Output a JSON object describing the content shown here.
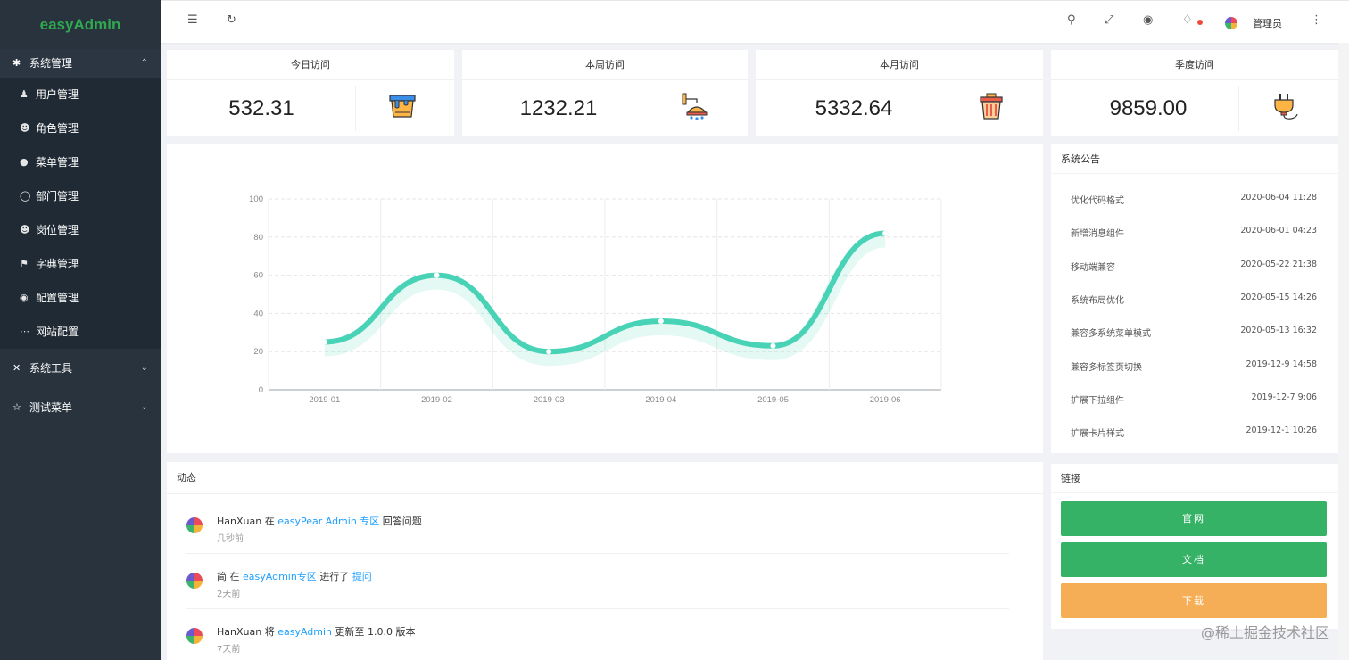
{
  "app": {
    "logo": "easyAdmin"
  },
  "sidebar": {
    "system": {
      "label": "系统管理",
      "items": [
        {
          "label": "用户管理",
          "icon": "user-icon"
        },
        {
          "label": "角色管理",
          "icon": "role-icon"
        },
        {
          "label": "菜单管理",
          "icon": "menu-icon"
        },
        {
          "label": "部门管理",
          "icon": "shield-icon"
        },
        {
          "label": "岗位管理",
          "icon": "post-icon"
        },
        {
          "label": "字典管理",
          "icon": "flag-icon"
        },
        {
          "label": "配置管理",
          "icon": "globe-icon"
        },
        {
          "label": "网站配置",
          "icon": "dots-icon"
        }
      ]
    },
    "tools": {
      "label": "系统工具"
    },
    "test": {
      "label": "测试菜单"
    }
  },
  "header": {
    "admin_name": "管理员"
  },
  "stats": [
    {
      "title": "今日访问",
      "value": "532.31",
      "icon": "paint-bucket-icon"
    },
    {
      "title": "本周访问",
      "value": "1232.21",
      "icon": "lamp-icon"
    },
    {
      "title": "本月访问",
      "value": "5332.64",
      "icon": "trash-icon"
    },
    {
      "title": "季度访问",
      "value": "9859.00",
      "icon": "plug-icon"
    }
  ],
  "chart_data": {
    "type": "line",
    "categories": [
      "2019-01",
      "2019-02",
      "2019-03",
      "2019-04",
      "2019-05",
      "2019-06"
    ],
    "values": [
      25,
      60,
      20,
      36,
      23,
      82
    ],
    "ylim": [
      0,
      100
    ],
    "yticks": [
      "0",
      "20",
      "40",
      "60",
      "80",
      "100"
    ],
    "color": "#48d2b6",
    "smooth": true,
    "grid": true
  },
  "notice": {
    "title": "系统公告",
    "items": [
      {
        "title": "优化代码格式",
        "time": "2020-06-04 11:28"
      },
      {
        "title": "新增消息组件",
        "time": "2020-06-01 04:23"
      },
      {
        "title": "移动端兼容",
        "time": "2020-05-22 21:38"
      },
      {
        "title": "系统布局优化",
        "time": "2020-05-15 14:26"
      },
      {
        "title": "兼容多系统菜单模式",
        "time": "2020-05-13 16:32"
      },
      {
        "title": "兼容多标签页切换",
        "time": "2019-12-9 14:58"
      },
      {
        "title": "扩展下拉组件",
        "time": "2019-12-7 9:06"
      },
      {
        "title": "扩展卡片样式",
        "time": "2019-12-1 10:26"
      }
    ]
  },
  "activity": {
    "title": "动态",
    "items": [
      {
        "user": "HanXuan",
        "p1": "在",
        "link1": "easyPear Admin 专区",
        "p2": "回答问题",
        "link2": "",
        "time": "几秒前"
      },
      {
        "user": "简",
        "p1": "在",
        "link1": "easyAdmin专区",
        "p2": "进行了",
        "link2": "提问",
        "time": "2天前"
      },
      {
        "user": "HanXuan",
        "p1": "将",
        "link1": "easyAdmin",
        "p2": "更新至 1.0.0 版本",
        "link2": "",
        "time": "7天前"
      }
    ]
  },
  "links": {
    "title": "链接",
    "buttons": [
      {
        "label": "官网",
        "color": "#35b265"
      },
      {
        "label": "文档",
        "color": "#35b265"
      },
      {
        "label": "下载",
        "color": "#f5ae55"
      }
    ]
  },
  "watermark": "@稀土掘金技术社区"
}
